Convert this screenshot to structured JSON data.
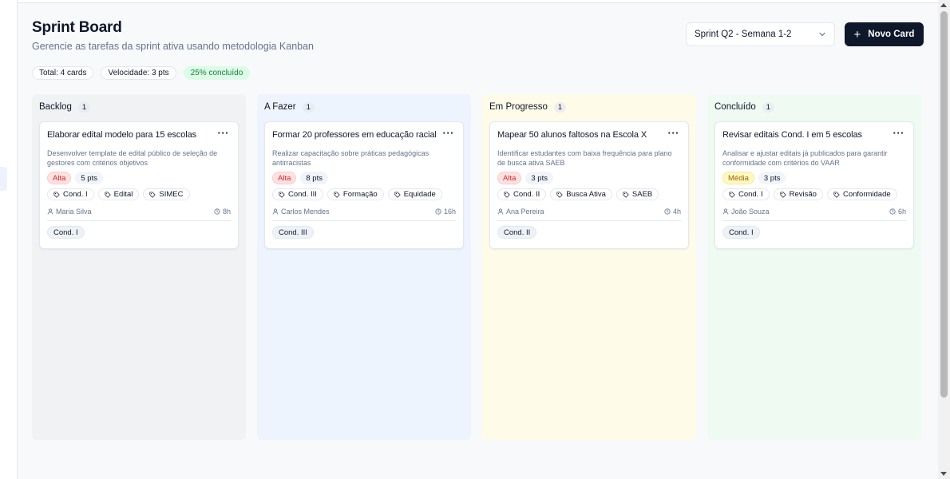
{
  "header": {
    "title": "Sprint Board",
    "subtitle": "Gerencie as tarefas da sprint ativa usando metodologia Kanban"
  },
  "stats": {
    "total": "Total: 4 cards",
    "velocity": "Velocidade: 3 pts",
    "completion": "25% concluído"
  },
  "toolbar": {
    "sprint_selected": "Sprint Q2 - Semana 1-2",
    "new_card_label": "Novo Card"
  },
  "columns": [
    {
      "title": "Backlog",
      "count": "1",
      "color": "#f1f2f4",
      "card": {
        "title": "Elaborar edital modelo para 15 escolas",
        "description": "Desenvolver template de edital público de seleção de gestores com critérios objetivos",
        "priority": "Alta",
        "points": "5 pts",
        "tags": [
          "Cond. I",
          "Edital",
          "SIMEC"
        ],
        "assignee": "Maria Silva",
        "estimate": "8h",
        "condition": "Cond. I"
      }
    },
    {
      "title": "A Fazer",
      "count": "1",
      "color": "#eef4fd",
      "card": {
        "title": "Formar 20 professores em educação racial",
        "description": "Realizar capacitação sobre práticas pedagógicas antirracistas",
        "priority": "Alta",
        "points": "8 pts",
        "tags": [
          "Cond. III",
          "Formação",
          "Equidade"
        ],
        "assignee": "Carlos Mendes",
        "estimate": "16h",
        "condition": "Cond. III"
      }
    },
    {
      "title": "Em Progresso",
      "count": "1",
      "color": "#fefbe8",
      "card": {
        "title": "Mapear 50 alunos faltosos na Escola X",
        "description": "Identificar estudantes com baixa frequência para plano de busca ativa SAEB",
        "priority": "Alta",
        "points": "3 pts",
        "tags": [
          "Cond. II",
          "Busca Ativa",
          "SAEB"
        ],
        "assignee": "Ana Pereira",
        "estimate": "4h",
        "condition": "Cond. II"
      }
    },
    {
      "title": "Concluído",
      "count": "1",
      "color": "#effbf2",
      "card": {
        "title": "Revisar editais Cond. I em 5 escolas",
        "description": "Analisar e ajustar editais já publicados para garantir conformidade com critérios do VAAR",
        "priority": "Média",
        "points": "3 pts",
        "tags": [
          "Cond. I",
          "Revisão",
          "Conformidade"
        ],
        "assignee": "João Souza",
        "estimate": "6h",
        "condition": "Cond. I"
      }
    }
  ]
}
